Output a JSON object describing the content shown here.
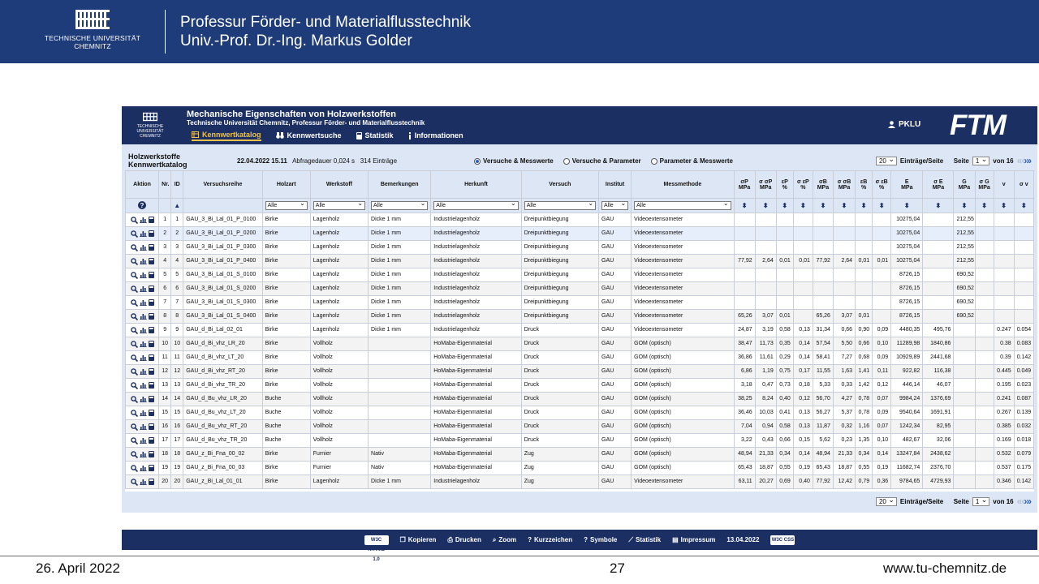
{
  "slide": {
    "logo_text": [
      "TECHNISCHE UNIVERSITÄT",
      "CHEMNITZ"
    ],
    "title_line1": "Professur Förder- und Materialflusstechnik",
    "title_line2": "Univ.-Prof. Dr.-Ing. Markus Golder",
    "footer_date": "26. April 2022",
    "footer_page": "27",
    "footer_url": "www.tu-chemnitz.de",
    "colors": {
      "header_bg": "#1e3b7a",
      "app_bg": "#1b2f63",
      "accent": "#f0c24b"
    }
  },
  "app": {
    "logo_text": [
      "TECHNISCHE UNIVERSITÄT",
      "CHEMNITZ"
    ],
    "title": "Mechanische Eigenschaften von Holzwerkstoffen",
    "subtitle": "Technische Universität Chemnitz, Professur Förder- und Materialflusstechnik",
    "nav": [
      {
        "label": "Kennwertkatalog",
        "icon": "table-icon",
        "active": true
      },
      {
        "label": "Kennwertsuche",
        "icon": "binoculars-icon",
        "active": false
      },
      {
        "label": "Statistik",
        "icon": "calculator-icon",
        "active": false
      },
      {
        "label": "Informationen",
        "icon": "info-icon",
        "active": false
      }
    ],
    "user": "PKLU",
    "brand": "FTM"
  },
  "toolbar": {
    "title_line1": "Holzwerkstoffe",
    "title_line2": "Kennwertkatalog",
    "timestamp": "22.04.2022 15.11",
    "query_time": "Abfragedauer 0,024 s",
    "entries": "314  Einträge",
    "radios": [
      {
        "label": "Versuche & Messwerte",
        "checked": true
      },
      {
        "label": "Versuche & Parameter",
        "checked": false
      },
      {
        "label": "Parameter & Messwerte",
        "checked": false
      }
    ],
    "per_page_value": "20",
    "per_page_label": "Einträge/Seite",
    "page_label": "Seite",
    "page_value": "1",
    "of_pages": "von 16"
  },
  "table": {
    "headers": [
      "Aktion",
      "Nr.",
      "ID",
      "Versuchsreihe",
      "Holzart",
      "Werkstoff",
      "Bemerkungen",
      "Herkunft",
      "Versuch",
      "Institut",
      "Messmethode"
    ],
    "measure_headers": [
      [
        "σP",
        "MPa"
      ],
      [
        "σ σP",
        "MPa"
      ],
      [
        "εP",
        "%"
      ],
      [
        "σ εP",
        "%"
      ],
      [
        "σB",
        "MPa"
      ],
      [
        "σ σB",
        "MPa"
      ],
      [
        "εB",
        "%"
      ],
      [
        "σ εB",
        "%"
      ],
      [
        "E",
        "MPa"
      ],
      [
        "σ E",
        "MPa"
      ],
      [
        "G",
        "MPa"
      ],
      [
        "σ G",
        "MPa"
      ],
      [
        "v",
        ""
      ],
      [
        "σ v",
        ""
      ]
    ],
    "filter_value": "Alle",
    "rows": [
      {
        "nr": "1",
        "id": "1",
        "reihe": "GAU_3_Bi_Lal_01_P_0100",
        "holzart": "Birke",
        "werkstoff": "Lagenholz",
        "bem": "Dicke 1 mm",
        "herkunft": "Industrielagenholz",
        "versuch": "Dreipunktbiegung",
        "inst": "GAU",
        "methode": "Videoextensometer",
        "m": [
          "",
          "",
          "",
          "",
          "",
          "",
          "",
          "",
          "10275,04",
          "",
          "212,55",
          "",
          "",
          ""
        ]
      },
      {
        "nr": "2",
        "id": "2",
        "reihe": "GAU_3_Bi_Lal_01_P_0200",
        "holzart": "Birke",
        "werkstoff": "Lagenholz",
        "bem": "Dicke 1 mm",
        "herkunft": "Industrielagenholz",
        "versuch": "Dreipunktbiegung",
        "inst": "GAU",
        "methode": "Videoextensometer",
        "m": [
          "",
          "",
          "",
          "",
          "",
          "",
          "",
          "",
          "10275,04",
          "",
          "212,55",
          "",
          "",
          ""
        ]
      },
      {
        "nr": "3",
        "id": "3",
        "reihe": "GAU_3_Bi_Lal_01_P_0300",
        "holzart": "Birke",
        "werkstoff": "Lagenholz",
        "bem": "Dicke 1 mm",
        "herkunft": "Industrielagenholz",
        "versuch": "Dreipunktbiegung",
        "inst": "GAU",
        "methode": "Videoextensometer",
        "m": [
          "",
          "",
          "",
          "",
          "",
          "",
          "",
          "",
          "10275,04",
          "",
          "212,55",
          "",
          "",
          ""
        ]
      },
      {
        "nr": "4",
        "id": "4",
        "reihe": "GAU_3_Bi_Lal_01_P_0400",
        "holzart": "Birke",
        "werkstoff": "Lagenholz",
        "bem": "Dicke 1 mm",
        "herkunft": "Industrielagenholz",
        "versuch": "Dreipunktbiegung",
        "inst": "GAU",
        "methode": "Videoextensometer",
        "m": [
          "77,92",
          "2,64",
          "0,01",
          "0,01",
          "77,92",
          "2,64",
          "0,01",
          "0,01",
          "10275,04",
          "",
          "212,55",
          "",
          "",
          ""
        ]
      },
      {
        "nr": "5",
        "id": "5",
        "reihe": "GAU_3_Bi_Lal_01_S_0100",
        "holzart": "Birke",
        "werkstoff": "Lagenholz",
        "bem": "Dicke 1 mm",
        "herkunft": "Industrielagenholz",
        "versuch": "Dreipunktbiegung",
        "inst": "GAU",
        "methode": "Videoextensometer",
        "m": [
          "",
          "",
          "",
          "",
          "",
          "",
          "",
          "",
          "8726,15",
          "",
          "690,52",
          "",
          "",
          ""
        ]
      },
      {
        "nr": "6",
        "id": "6",
        "reihe": "GAU_3_Bi_Lal_01_S_0200",
        "holzart": "Birke",
        "werkstoff": "Lagenholz",
        "bem": "Dicke 1 mm",
        "herkunft": "Industrielagenholz",
        "versuch": "Dreipunktbiegung",
        "inst": "GAU",
        "methode": "Videoextensometer",
        "m": [
          "",
          "",
          "",
          "",
          "",
          "",
          "",
          "",
          "8726,15",
          "",
          "690,52",
          "",
          "",
          ""
        ]
      },
      {
        "nr": "7",
        "id": "7",
        "reihe": "GAU_3_Bi_Lal_01_S_0300",
        "holzart": "Birke",
        "werkstoff": "Lagenholz",
        "bem": "Dicke 1 mm",
        "herkunft": "Industrielagenholz",
        "versuch": "Dreipunktbiegung",
        "inst": "GAU",
        "methode": "Videoextensometer",
        "m": [
          "",
          "",
          "",
          "",
          "",
          "",
          "",
          "",
          "8726,15",
          "",
          "690,52",
          "",
          "",
          ""
        ]
      },
      {
        "nr": "8",
        "id": "8",
        "reihe": "GAU_3_Bi_Lal_01_S_0400",
        "holzart": "Birke",
        "werkstoff": "Lagenholz",
        "bem": "Dicke 1 mm",
        "herkunft": "Industrielagenholz",
        "versuch": "Dreipunktbiegung",
        "inst": "GAU",
        "methode": "Videoextensometer",
        "m": [
          "65,26",
          "3,07",
          "0,01",
          "",
          "65,26",
          "3,07",
          "0,01",
          "",
          "8726,15",
          "",
          "690,52",
          "",
          "",
          ""
        ]
      },
      {
        "nr": "9",
        "id": "9",
        "reihe": "GAU_d_Bi_Lal_02_01",
        "holzart": "Birke",
        "werkstoff": "Lagenholz",
        "bem": "Dicke 1 mm",
        "herkunft": "Industrielagenholz",
        "versuch": "Druck",
        "inst": "GAU",
        "methode": "Videoextensometer",
        "m": [
          "24,87",
          "3,19",
          "0,58",
          "0,13",
          "31,34",
          "0,66",
          "0,90",
          "0,09",
          "4480,35",
          "495,76",
          "",
          "",
          "0.247",
          "0.054"
        ]
      },
      {
        "nr": "10",
        "id": "10",
        "reihe": "GAU_d_Bi_vhz_LR_20",
        "holzart": "Birke",
        "werkstoff": "Vollholz",
        "bem": "",
        "herkunft": "HoMaba-Eigenmaterial",
        "versuch": "Druck",
        "inst": "GAU",
        "methode": "GOM (optisch)",
        "m": [
          "38,47",
          "11,73",
          "0,35",
          "0,14",
          "57,54",
          "5,50",
          "0,66",
          "0,10",
          "11289,98",
          "1840,86",
          "",
          "",
          "0.38",
          "0.083"
        ]
      },
      {
        "nr": "11",
        "id": "11",
        "reihe": "GAU_d_Bi_vhz_LT_20",
        "holzart": "Birke",
        "werkstoff": "Vollholz",
        "bem": "",
        "herkunft": "HoMaba-Eigenmaterial",
        "versuch": "Druck",
        "inst": "GAU",
        "methode": "GOM (optisch)",
        "m": [
          "36,86",
          "11,61",
          "0,29",
          "0,14",
          "58,41",
          "7,27",
          "0,68",
          "0,09",
          "10929,89",
          "2441,68",
          "",
          "",
          "0.39",
          "0.142"
        ]
      },
      {
        "nr": "12",
        "id": "12",
        "reihe": "GAU_d_Bi_vhz_RT_20",
        "holzart": "Birke",
        "werkstoff": "Vollholz",
        "bem": "",
        "herkunft": "HoMaba-Eigenmaterial",
        "versuch": "Druck",
        "inst": "GAU",
        "methode": "GOM (optisch)",
        "m": [
          "6,86",
          "1,19",
          "0,75",
          "0,17",
          "11,55",
          "1,63",
          "1,41",
          "0,11",
          "922,82",
          "116,38",
          "",
          "",
          "0.445",
          "0.049"
        ]
      },
      {
        "nr": "13",
        "id": "13",
        "reihe": "GAU_d_Bi_vhz_TR_20",
        "holzart": "Birke",
        "werkstoff": "Vollholz",
        "bem": "",
        "herkunft": "HoMaba-Eigenmaterial",
        "versuch": "Druck",
        "inst": "GAU",
        "methode": "GOM (optisch)",
        "m": [
          "3,18",
          "0,47",
          "0,73",
          "0,18",
          "5,33",
          "0,33",
          "1,42",
          "0,12",
          "446,14",
          "46,07",
          "",
          "",
          "0.195",
          "0.023"
        ]
      },
      {
        "nr": "14",
        "id": "14",
        "reihe": "GAU_d_Bu_vhz_LR_20",
        "holzart": "Buche",
        "werkstoff": "Vollholz",
        "bem": "",
        "herkunft": "HoMaba-Eigenmaterial",
        "versuch": "Druck",
        "inst": "GAU",
        "methode": "GOM (optisch)",
        "m": [
          "38,25",
          "8,24",
          "0,40",
          "0,12",
          "56,70",
          "4,27",
          "0,78",
          "0,07",
          "9984,24",
          "1376,69",
          "",
          "",
          "0.241",
          "0.087"
        ]
      },
      {
        "nr": "15",
        "id": "15",
        "reihe": "GAU_d_Bu_vhz_LT_20",
        "holzart": "Buche",
        "werkstoff": "Vollholz",
        "bem": "",
        "herkunft": "HoMaba-Eigenmaterial",
        "versuch": "Druck",
        "inst": "GAU",
        "methode": "GOM (optisch)",
        "m": [
          "36,46",
          "10,03",
          "0,41",
          "0,13",
          "56,27",
          "5,37",
          "0,78",
          "0,09",
          "9540,64",
          "1691,91",
          "",
          "",
          "0.267",
          "0.139"
        ]
      },
      {
        "nr": "16",
        "id": "16",
        "reihe": "GAU_d_Bu_vhz_RT_20",
        "holzart": "Buche",
        "werkstoff": "Vollholz",
        "bem": "",
        "herkunft": "HoMaba-Eigenmaterial",
        "versuch": "Druck",
        "inst": "GAU",
        "methode": "GOM (optisch)",
        "m": [
          "7,04",
          "0,94",
          "0,58",
          "0,13",
          "11,87",
          "0,32",
          "1,16",
          "0,07",
          "1242,34",
          "82,95",
          "",
          "",
          "0.385",
          "0.032"
        ]
      },
      {
        "nr": "17",
        "id": "17",
        "reihe": "GAU_d_Bu_vhz_TR_20",
        "holzart": "Buche",
        "werkstoff": "Vollholz",
        "bem": "",
        "herkunft": "HoMaba-Eigenmaterial",
        "versuch": "Druck",
        "inst": "GAU",
        "methode": "GOM (optisch)",
        "m": [
          "3,22",
          "0,43",
          "0,66",
          "0,15",
          "5,62",
          "0,23",
          "1,35",
          "0,10",
          "482,67",
          "32,06",
          "",
          "",
          "0.169",
          "0.018"
        ]
      },
      {
        "nr": "18",
        "id": "18",
        "reihe": "GAU_z_Bi_Fna_00_02",
        "holzart": "Birke",
        "werkstoff": "Furnier",
        "bem": "Nativ",
        "herkunft": "HoMaba-Eigenmaterial",
        "versuch": "Zug",
        "inst": "GAU",
        "methode": "GOM (optisch)",
        "m": [
          "48,94",
          "21,33",
          "0,34",
          "0,14",
          "48,94",
          "21,33",
          "0,34",
          "0,14",
          "13247,84",
          "2438,62",
          "",
          "",
          "0.532",
          "0.079"
        ]
      },
      {
        "nr": "19",
        "id": "19",
        "reihe": "GAU_z_Bi_Fna_00_03",
        "holzart": "Birke",
        "werkstoff": "Furnier",
        "bem": "Nativ",
        "herkunft": "HoMaba-Eigenmaterial",
        "versuch": "Zug",
        "inst": "GAU",
        "methode": "GOM (optisch)",
        "m": [
          "65,43",
          "18,87",
          "0,55",
          "0,19",
          "65,43",
          "18,87",
          "0,55",
          "0,19",
          "11682,74",
          "2376,70",
          "",
          "",
          "0.537",
          "0.175"
        ]
      },
      {
        "nr": "20",
        "id": "20",
        "reihe": "GAU_z_Bi_Lal_01_01",
        "holzart": "Birke",
        "werkstoff": "Lagenholz",
        "bem": "Dicke 1 mm",
        "herkunft": "Industrielagenholz",
        "versuch": "Zug",
        "inst": "GAU",
        "methode": "Videoextensometer",
        "m": [
          "63,11",
          "20,27",
          "0,69",
          "0,40",
          "77,92",
          "12,42",
          "0,79",
          "0,36",
          "9784,65",
          "4729,93",
          "",
          "",
          "0.346",
          "0.142"
        ]
      }
    ]
  },
  "footer": {
    "items": [
      {
        "label": "Kopieren",
        "icon": "copy-icon"
      },
      {
        "label": "Drucken",
        "icon": "print-icon"
      },
      {
        "label": "Zoom",
        "icon": "zoom-icon"
      },
      {
        "label": "Kurzzeichen",
        "icon": "help-icon"
      },
      {
        "label": "Symbole",
        "icon": "help-icon"
      },
      {
        "label": "Statistik",
        "icon": "chart-icon"
      },
      {
        "label": "Impressum",
        "icon": "document-icon"
      }
    ],
    "date": "13.04.2022",
    "badge_left": "W3C XHTML 1.0",
    "badge_right": "W3C CSS"
  }
}
